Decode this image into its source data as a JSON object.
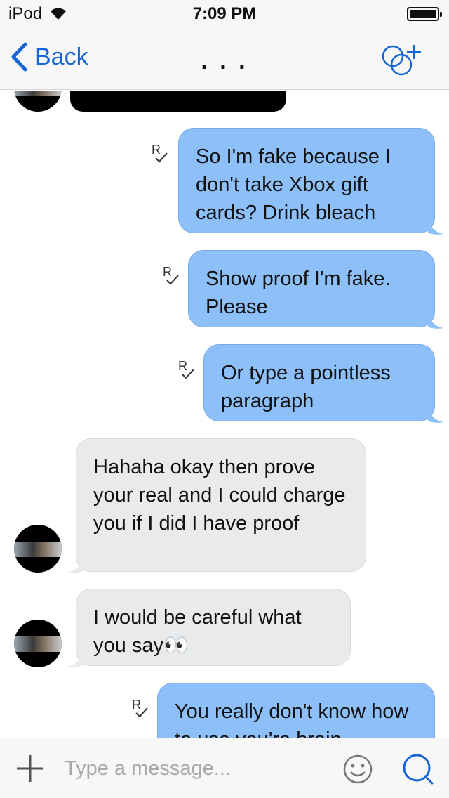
{
  "status_bar": {
    "carrier": "iPod",
    "time": "7:09 PM"
  },
  "nav": {
    "back_label": "Back",
    "title": ". . ."
  },
  "messages": [
    {
      "direction": "incoming",
      "type": "image",
      "text": ""
    },
    {
      "direction": "outgoing",
      "text": "So I'm fake because I don't take Xbox gift cards? Drink bleach",
      "read": true
    },
    {
      "direction": "outgoing",
      "text": "Show proof I'm fake. Please",
      "read": true
    },
    {
      "direction": "outgoing",
      "text": "Or type a pointless paragraph",
      "read": true
    },
    {
      "direction": "incoming",
      "text": "Hahaha okay then prove your real and I could charge you if I did I have proof"
    },
    {
      "direction": "incoming",
      "text": "I would be careful what you say👀"
    },
    {
      "direction": "outgoing",
      "text": "You really don't know how to use you're brain",
      "read": true
    }
  ],
  "input": {
    "placeholder": "Type a message..."
  },
  "colors": {
    "accent": "#1565d8",
    "outgoing_bubble": "#8dbff8",
    "incoming_bubble": "#e9eaec"
  },
  "icons": [
    "wifi-icon",
    "battery-icon",
    "chevron-left-icon",
    "add-participant-icon",
    "read-receipt-icon",
    "plus-icon",
    "emoji-icon",
    "send-icon"
  ]
}
